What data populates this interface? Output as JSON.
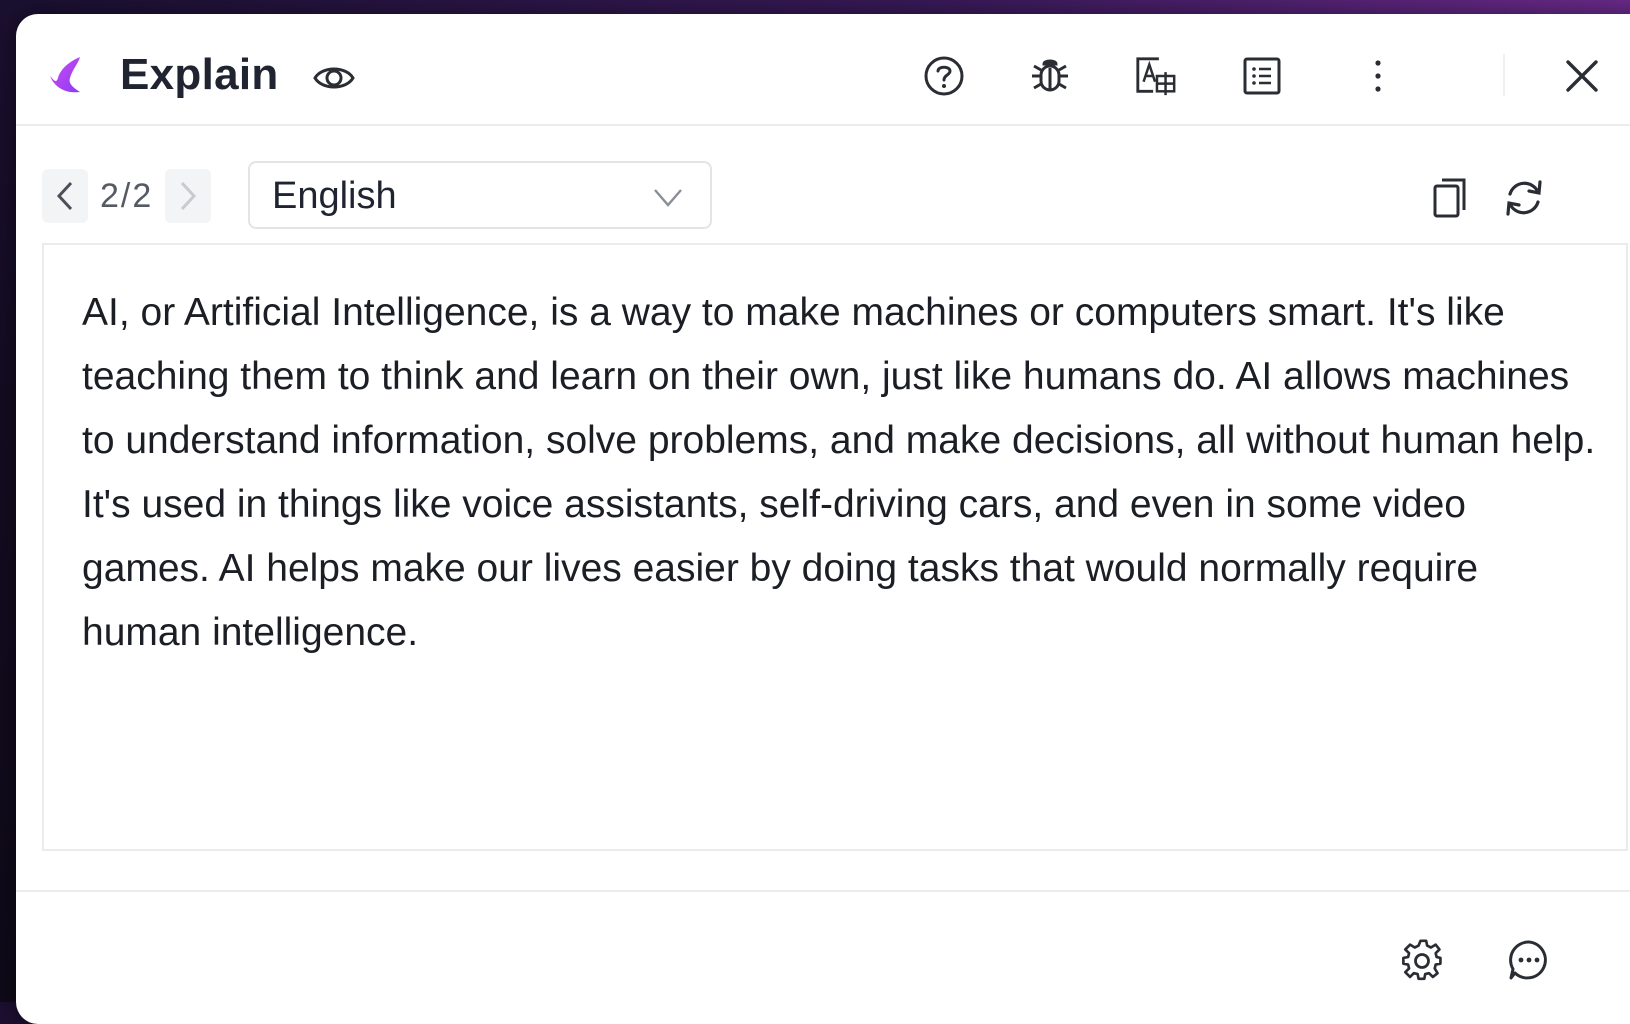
{
  "header": {
    "title": "Explain"
  },
  "toolbar": {
    "page_count": "2/2",
    "language": "English"
  },
  "content": {
    "text": "AI, or Artificial Intelligence, is a way to make machines or computers smart. It's like teaching them to think and learn on their own, just like humans do. AI allows machines to understand information, solve problems, and make decisions, all without human help. It's used in things like voice assistants, self-driving cars, and even in some video games. AI helps make our lives easier by doing tasks that would normally require human intelligence."
  },
  "icons": {
    "logo": "app-logo-icon",
    "visibility": "eye-icon",
    "help": "help-icon",
    "debug": "bug-icon",
    "translate": "translate-icon",
    "list": "list-icon",
    "more": "more-vertical-icon",
    "close": "close-icon",
    "prev": "chevron-left-icon",
    "next": "chevron-right-icon",
    "dropdown": "chevron-down-icon",
    "copy": "copy-icon",
    "regenerate": "refresh-icon",
    "settings": "gear-icon",
    "chat": "chat-icon"
  },
  "colors": {
    "brand": "#b84cf0",
    "text": "#1f2430",
    "icon": "#2a2d33"
  }
}
